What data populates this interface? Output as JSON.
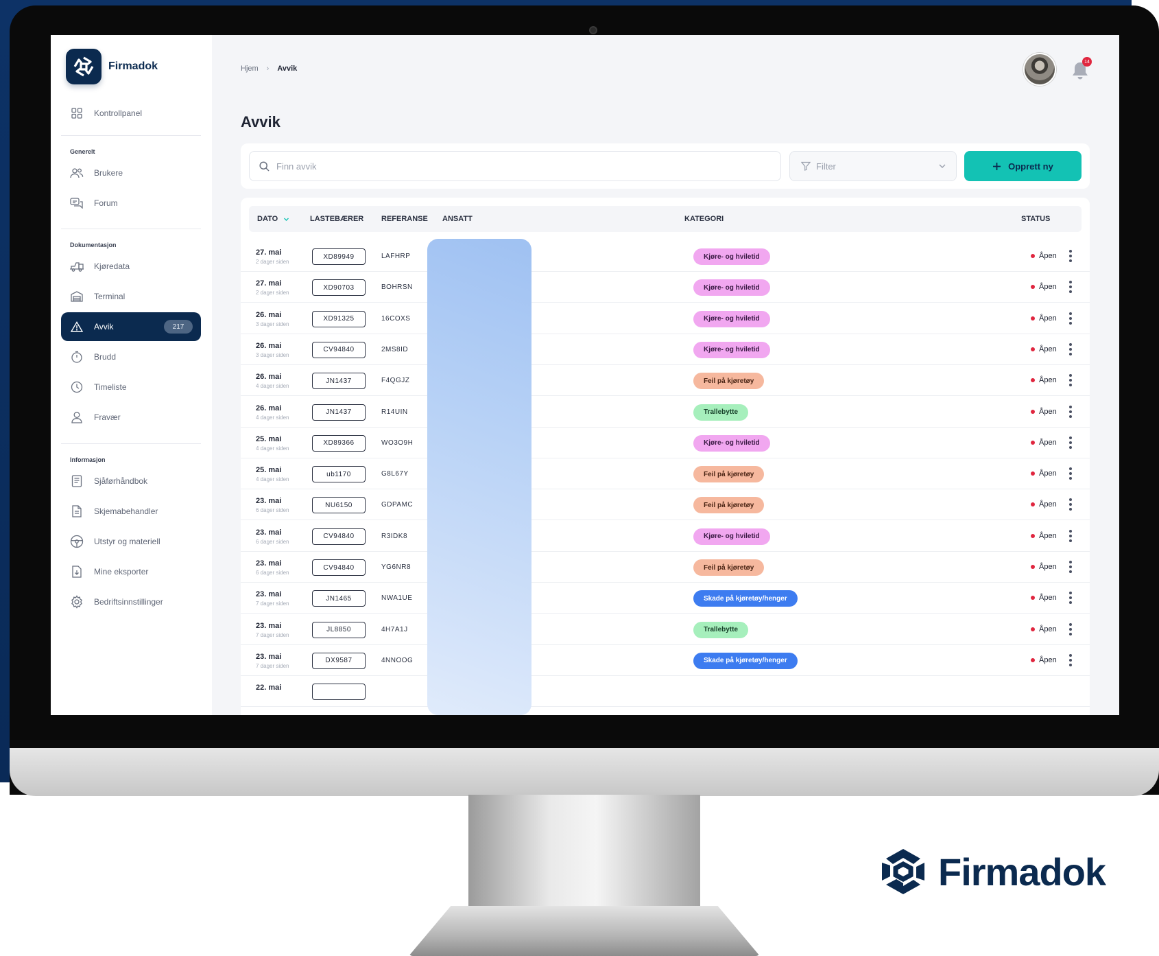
{
  "brand": {
    "name": "Firmadok",
    "accent": "#0b2a4f",
    "teal": "#13c2b4"
  },
  "sidebar": {
    "top_item": {
      "label": "Kontrollpanel",
      "icon": "grid-icon"
    },
    "sections": [
      {
        "title": "Generelt"
      },
      {
        "title": "Dokumentasjon"
      },
      {
        "title": "Informasjon"
      }
    ],
    "items": [
      {
        "label": "Brukere",
        "icon": "users-icon"
      },
      {
        "label": "Forum",
        "icon": "chat-icon"
      },
      {
        "label": "Kjøredata",
        "icon": "truck-icon"
      },
      {
        "label": "Terminal",
        "icon": "terminal-icon"
      },
      {
        "label": "Avvik",
        "icon": "warning-icon",
        "badge": "217",
        "active": true
      },
      {
        "label": "Brudd",
        "icon": "timer-icon"
      },
      {
        "label": "Timeliste",
        "icon": "clock-icon"
      },
      {
        "label": "Fravær",
        "icon": "person-icon"
      },
      {
        "label": "Sjåførhåndbok",
        "icon": "book-icon"
      },
      {
        "label": "Skjemabehandler",
        "icon": "form-icon"
      },
      {
        "label": "Utstyr og materiell",
        "icon": "steering-wheel-icon"
      },
      {
        "label": "Mine eksporter",
        "icon": "export-icon"
      },
      {
        "label": "Bedriftsinnstillinger",
        "icon": "gear-icon"
      }
    ]
  },
  "header": {
    "breadcrumb": [
      "Hjem",
      "Avvik"
    ],
    "notification_count": "14"
  },
  "page": {
    "title": "Avvik",
    "search_placeholder": "Finn avvik",
    "filter_label": "Filter",
    "create_label": "Opprett ny"
  },
  "table": {
    "columns": [
      "DATO",
      "LASTEBÆRER",
      "REFERANSE",
      "ANSATT",
      "KATEGORI",
      "STATUS"
    ],
    "rows": [
      {
        "date": "27. mai",
        "ago": "2 dager siden",
        "plate": "XD89949",
        "ref": "LAFHRP",
        "category": "Kjøre- og hviletid",
        "status": "Åpen"
      },
      {
        "date": "27. mai",
        "ago": "2 dager siden",
        "plate": "XD90703",
        "ref": "BOHRSN",
        "category": "Kjøre- og hviletid",
        "status": "Åpen"
      },
      {
        "date": "26. mai",
        "ago": "3 dager siden",
        "plate": "XD91325",
        "ref": "16COXS",
        "category": "Kjøre- og hviletid",
        "status": "Åpen"
      },
      {
        "date": "26. mai",
        "ago": "3 dager siden",
        "plate": "CV94840",
        "ref": "2MS8ID",
        "category": "Kjøre- og hviletid",
        "status": "Åpen"
      },
      {
        "date": "26. mai",
        "ago": "4 dager siden",
        "plate": "JN1437",
        "ref": "F4QGJZ",
        "category": "Feil på kjøretøy",
        "status": "Åpen"
      },
      {
        "date": "26. mai",
        "ago": "4 dager siden",
        "plate": "JN1437",
        "ref": "R14UIN",
        "category": "Trallebytte",
        "status": "Åpen"
      },
      {
        "date": "25. mai",
        "ago": "4 dager siden",
        "plate": "XD89366",
        "ref": "WO3O9H",
        "category": "Kjøre- og hviletid",
        "status": "Åpen"
      },
      {
        "date": "25. mai",
        "ago": "4 dager siden",
        "plate": "ub1170",
        "ref": "G8L67Y",
        "category": "Feil på kjøretøy",
        "status": "Åpen"
      },
      {
        "date": "23. mai",
        "ago": "6 dager siden",
        "plate": "NU6150",
        "ref": "GDPAMC",
        "category": "Feil på kjøretøy",
        "status": "Åpen"
      },
      {
        "date": "23. mai",
        "ago": "6 dager siden",
        "plate": "CV94840",
        "ref": "R3IDK8",
        "category": "Kjøre- og hviletid",
        "status": "Åpen"
      },
      {
        "date": "23. mai",
        "ago": "6 dager siden",
        "plate": "CV94840",
        "ref": "YG6NR8",
        "category": "Feil på kjøretøy",
        "status": "Åpen"
      },
      {
        "date": "23. mai",
        "ago": "7 dager siden",
        "plate": "JN1465",
        "ref": "NWA1UE",
        "category": "Skade på kjøretøy/henger",
        "status": "Åpen"
      },
      {
        "date": "23. mai",
        "ago": "7 dager siden",
        "plate": "JL8850",
        "ref": "4H7A1J",
        "category": "Trallebytte",
        "status": "Åpen"
      },
      {
        "date": "23. mai",
        "ago": "7 dager siden",
        "plate": "DX9587",
        "ref": "4NNOOG",
        "category": "Skade på kjøretøy/henger",
        "status": "Åpen"
      },
      {
        "date": "22. mai",
        "ago": "",
        "plate": "",
        "ref": "",
        "category": "",
        "status": ""
      }
    ]
  },
  "category_colors": {
    "Kjøre- og hviletid": {
      "bg": "#f1a7f0",
      "fg": "#3b1b45"
    },
    "Feil på kjøretøy": {
      "bg": "#f6b89e",
      "fg": "#4a2414"
    },
    "Trallebytte": {
      "bg": "#a6efbc",
      "fg": "#17402a"
    },
    "Skade på kjøretøy/henger": {
      "bg": "#3d7cf0",
      "fg": "#ffffff"
    }
  }
}
